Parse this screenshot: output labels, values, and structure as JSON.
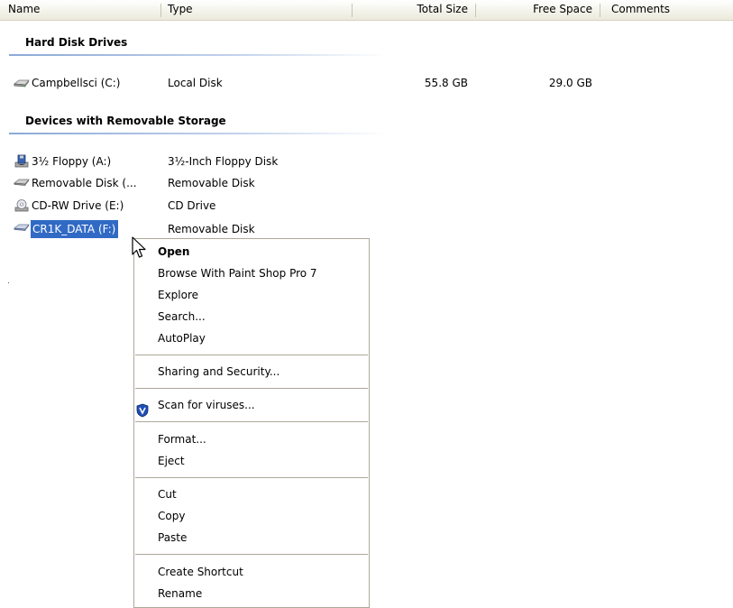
{
  "columns": [
    {
      "key": "name",
      "label": "Name"
    },
    {
      "key": "type",
      "label": "Type"
    },
    {
      "key": "total_size",
      "label": "Total Size"
    },
    {
      "key": "free_space",
      "label": "Free Space"
    },
    {
      "key": "comments",
      "label": "Comments"
    }
  ],
  "groups": {
    "hard_disk": {
      "title": "Hard Disk Drives",
      "items": [
        {
          "name": "Campbellsci (C:)",
          "type": "Local Disk",
          "total_size": "55.8 GB",
          "free_space": "29.0 GB",
          "icon": "hard-disk-icon"
        }
      ]
    },
    "removable": {
      "title": "Devices with Removable Storage",
      "items": [
        {
          "name": "3½ Floppy (A:)",
          "type": "3½-Inch Floppy Disk",
          "icon": "floppy-drive-icon"
        },
        {
          "name": "Removable Disk (...",
          "type": "Removable Disk",
          "icon": "removable-disk-icon"
        },
        {
          "name": "CD-RW Drive (E:)",
          "type": "CD Drive",
          "icon": "cd-drive-icon"
        },
        {
          "name": "CR1K_DATA (F:)",
          "type": "Removable Disk",
          "icon": "removable-disk-icon",
          "selected": true
        }
      ]
    }
  },
  "context_menu": {
    "items": [
      {
        "label": "Open",
        "bold": true
      },
      {
        "label": "Browse With Paint Shop Pro 7"
      },
      {
        "label": "Explore"
      },
      {
        "label": "Search..."
      },
      {
        "label": "AutoPlay"
      },
      {
        "label": "Sharing and Security..."
      },
      {
        "label": "Scan for viruses...",
        "icon": "shield-icon"
      },
      {
        "label": "Format..."
      },
      {
        "label": "Eject"
      },
      {
        "label": "Cut"
      },
      {
        "label": "Copy"
      },
      {
        "label": "Paste"
      },
      {
        "label": "Create Shortcut"
      },
      {
        "label": "Rename"
      }
    ]
  },
  "colors": {
    "selection": "#316ac5",
    "group_line": "#8ca9d7",
    "menu_border": "#aca899"
  }
}
